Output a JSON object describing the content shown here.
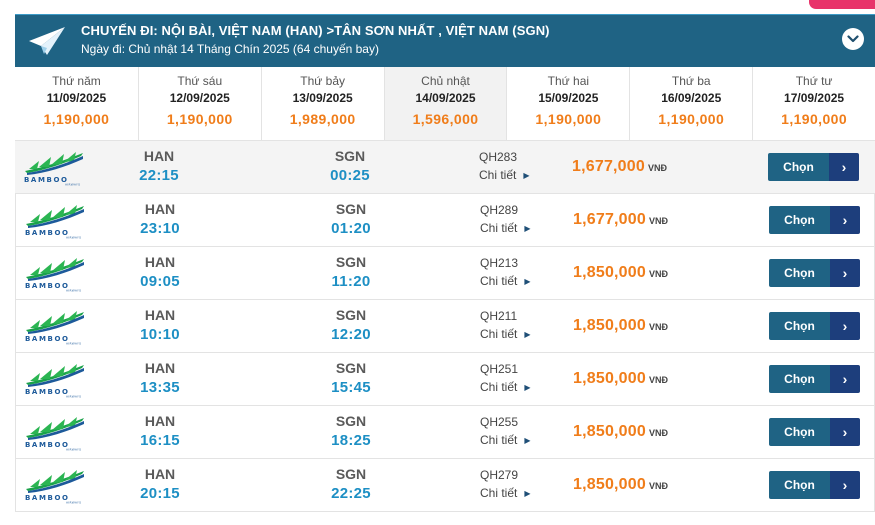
{
  "header": {
    "route": "CHUYẾN ĐI: NỘI BÀI, VIỆT NAM (HAN) >TÂN SƠN NHẤT , VIỆT NAM (SGN)",
    "date_info": "Ngày đi: Chủ nhật 14 Tháng Chín 2025 (64 chuyến bay)",
    "icon": "paper-plane-icon",
    "toggle_icon": "chevron-down-icon"
  },
  "dates": [
    {
      "dow": "Thứ năm",
      "date": "11/09/2025",
      "price": "1,190,000",
      "active": false
    },
    {
      "dow": "Thứ sáu",
      "date": "12/09/2025",
      "price": "1,190,000",
      "active": false
    },
    {
      "dow": "Thứ bảy",
      "date": "13/09/2025",
      "price": "1,989,000",
      "active": false
    },
    {
      "dow": "Chủ nhật",
      "date": "14/09/2025",
      "price": "1,596,000",
      "active": true
    },
    {
      "dow": "Thứ hai",
      "date": "15/09/2025",
      "price": "1,190,000",
      "active": false
    },
    {
      "dow": "Thứ ba",
      "date": "16/09/2025",
      "price": "1,190,000",
      "active": false
    },
    {
      "dow": "Thứ tư",
      "date": "17/09/2025",
      "price": "1,190,000",
      "active": false
    }
  ],
  "flight_labels": {
    "detail": "Chi tiết",
    "currency": "VNĐ",
    "select": "Chọn",
    "select_icon": "chevron-right-icon",
    "logo_text": "BAMBOO",
    "logo_sub": "AIRWAYS"
  },
  "flights": [
    {
      "from": "HAN",
      "dep": "22:15",
      "to": "SGN",
      "arr": "00:25",
      "flight_no": "QH283",
      "price": "1,677,000"
    },
    {
      "from": "HAN",
      "dep": "23:10",
      "to": "SGN",
      "arr": "01:20",
      "flight_no": "QH289",
      "price": "1,677,000"
    },
    {
      "from": "HAN",
      "dep": "09:05",
      "to": "SGN",
      "arr": "11:20",
      "flight_no": "QH213",
      "price": "1,850,000"
    },
    {
      "from": "HAN",
      "dep": "10:10",
      "to": "SGN",
      "arr": "12:20",
      "flight_no": "QH211",
      "price": "1,850,000"
    },
    {
      "from": "HAN",
      "dep": "13:35",
      "to": "SGN",
      "arr": "15:45",
      "flight_no": "QH251",
      "price": "1,850,000"
    },
    {
      "from": "HAN",
      "dep": "16:15",
      "to": "SGN",
      "arr": "18:25",
      "flight_no": "QH255",
      "price": "1,850,000"
    },
    {
      "from": "HAN",
      "dep": "20:15",
      "to": "SGN",
      "arr": "22:25",
      "flight_no": "QH279",
      "price": "1,850,000"
    }
  ],
  "colors": {
    "header_bg": "#1f6384",
    "price_orange": "#f07d1a",
    "time_blue": "#1d8fc4",
    "button_dark": "#1d3e7c",
    "accent_pink": "#e8336a",
    "bamboo_green": "#1aa24a"
  }
}
